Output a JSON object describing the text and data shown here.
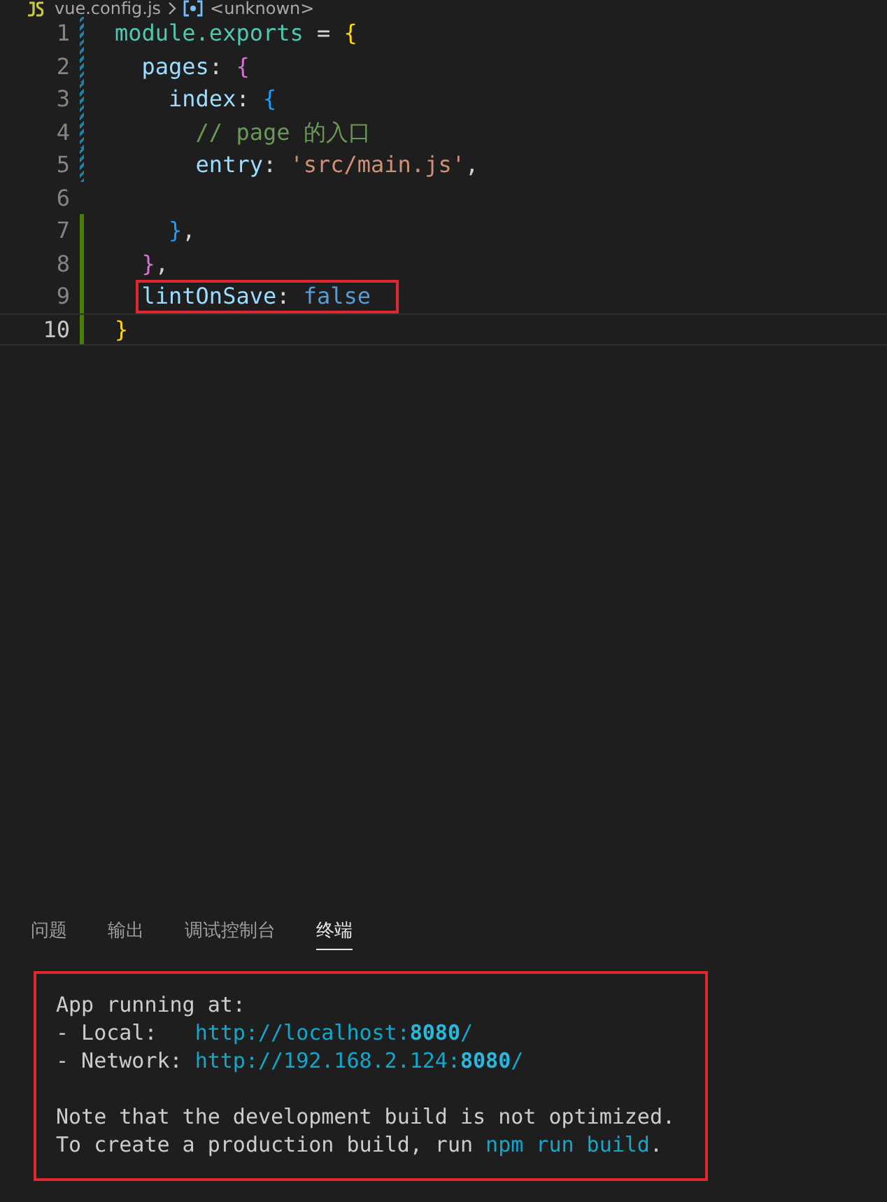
{
  "breadcrumb": {
    "file": "vue.config.js",
    "symbol": "<unknown>"
  },
  "editor": {
    "lines": [
      {
        "number": "1",
        "kind": "modified",
        "current": false,
        "highlighted": false,
        "tokens": [
          {
            "kind": "object",
            "text": "module.exports"
          },
          {
            "kind": "punct",
            "text": " = "
          },
          {
            "kind": "bracket1",
            "text": "{"
          }
        ]
      },
      {
        "number": "2",
        "kind": "modified",
        "current": false,
        "highlighted": false,
        "tokens": [
          {
            "kind": "property",
            "text": "  pages"
          },
          {
            "kind": "punct",
            "text": ": "
          },
          {
            "kind": "bracket2",
            "text": "{"
          }
        ]
      },
      {
        "number": "3",
        "kind": "modified",
        "current": false,
        "highlighted": false,
        "tokens": [
          {
            "kind": "property",
            "text": "    index"
          },
          {
            "kind": "punct",
            "text": ": "
          },
          {
            "kind": "bracket3",
            "text": "{"
          }
        ]
      },
      {
        "number": "4",
        "kind": "modified",
        "current": false,
        "highlighted": false,
        "tokens": [
          {
            "kind": "comment",
            "text": "      // page 的入口"
          }
        ]
      },
      {
        "number": "5",
        "kind": "modified",
        "current": false,
        "highlighted": false,
        "tokens": [
          {
            "kind": "property",
            "text": "      entry"
          },
          {
            "kind": "punct",
            "text": ": "
          },
          {
            "kind": "string",
            "text": "'src/main.js'"
          },
          {
            "kind": "punct",
            "text": ","
          }
        ]
      },
      {
        "number": "6",
        "kind": "unchanged",
        "current": false,
        "highlighted": false
      },
      {
        "number": "7",
        "kind": "added",
        "current": false,
        "highlighted": false,
        "tokens": [
          {
            "kind": "bracket3",
            "text": "    }"
          },
          {
            "kind": "punct",
            "text": ","
          }
        ]
      },
      {
        "number": "8",
        "kind": "added",
        "current": false,
        "highlighted": false,
        "tokens": [
          {
            "kind": "bracket2",
            "text": "  }"
          },
          {
            "kind": "punct",
            "text": ","
          }
        ]
      },
      {
        "number": "9",
        "kind": "added",
        "current": false,
        "highlighted": true,
        "tokens": [
          {
            "kind": "property",
            "text": "lintOnSave"
          },
          {
            "kind": "punct",
            "text": ": "
          },
          {
            "kind": "boolean",
            "text": "false"
          }
        ]
      },
      {
        "number": "10",
        "kind": "added",
        "current": true,
        "highlighted": false,
        "tokens": [
          {
            "kind": "bracket1",
            "text": "}"
          }
        ]
      }
    ]
  },
  "panel": {
    "tabs": [
      {
        "label": "问题",
        "selected": false
      },
      {
        "label": "输出",
        "selected": false
      },
      {
        "label": "调试控制台",
        "selected": false
      },
      {
        "label": "终端",
        "selected": true
      }
    ],
    "terminal": {
      "highlighted": true,
      "lines": [
        {
          "kind": "output",
          "segments": [
            {
              "kind": "text",
              "text": "App running at:"
            }
          ]
        },
        {
          "kind": "output",
          "segments": [
            {
              "kind": "text",
              "text": "- Local:   "
            },
            {
              "kind": "link",
              "text": "http://localhost:"
            },
            {
              "kind": "link-bold",
              "text": "8080"
            },
            {
              "kind": "link",
              "text": "/"
            }
          ]
        },
        {
          "kind": "output",
          "segments": [
            {
              "kind": "text",
              "text": "- Network: "
            },
            {
              "kind": "link",
              "text": "http://192.168.2.124:"
            },
            {
              "kind": "link-bold",
              "text": "8080"
            },
            {
              "kind": "link",
              "text": "/"
            }
          ]
        },
        {
          "kind": "blank"
        },
        {
          "kind": "output",
          "segments": [
            {
              "kind": "text",
              "text": "Note that the development build is not optimized."
            }
          ]
        },
        {
          "kind": "output",
          "segments": [
            {
              "kind": "text",
              "text": "To create a production build, run "
            },
            {
              "kind": "command",
              "text": "npm run build"
            },
            {
              "kind": "text",
              "text": "."
            }
          ]
        }
      ]
    }
  }
}
